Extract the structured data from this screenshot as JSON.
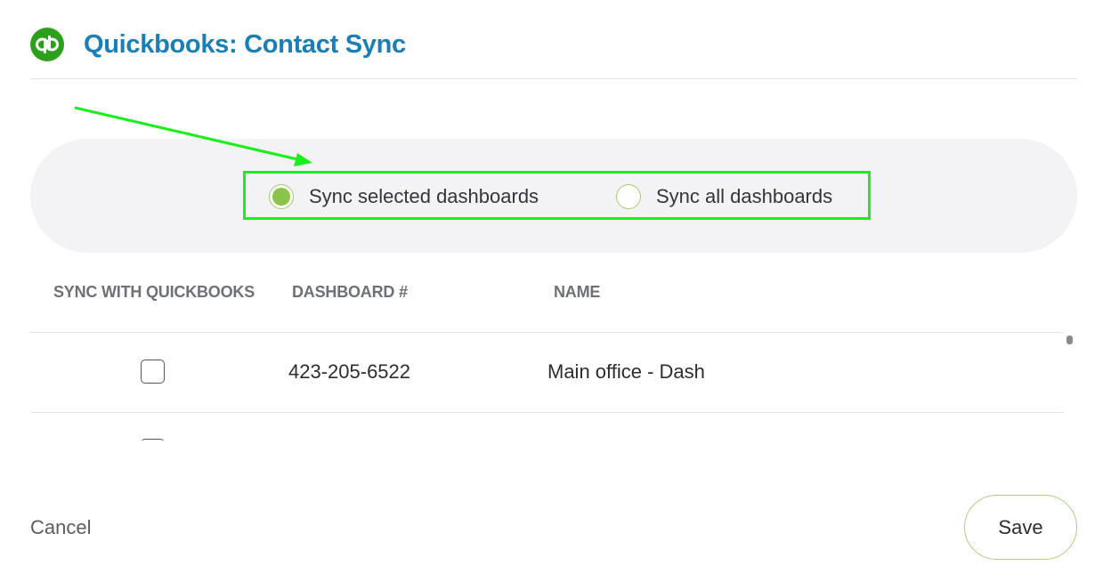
{
  "header": {
    "logo_icon": "quickbooks-logo",
    "title": "Quickbooks: Contact Sync"
  },
  "sync_options": {
    "selected_label": "Sync selected dashboards",
    "all_label": "Sync all dashboards",
    "selected_value": "selected"
  },
  "table": {
    "columns": {
      "sync": "SYNC WITH QUICKBOOKS",
      "dashboard": "DASHBOARD #",
      "name": "NAME"
    },
    "rows": [
      {
        "checked": false,
        "dashboard": "423-205-6522",
        "name": "Main office - Dash"
      }
    ]
  },
  "footer": {
    "cancel_label": "Cancel",
    "save_label": "Save"
  },
  "colors": {
    "title": "#1a7fb5",
    "brand_green": "#2ca01c",
    "radio_accent": "#8bc34a",
    "annotation": "#19f019"
  }
}
